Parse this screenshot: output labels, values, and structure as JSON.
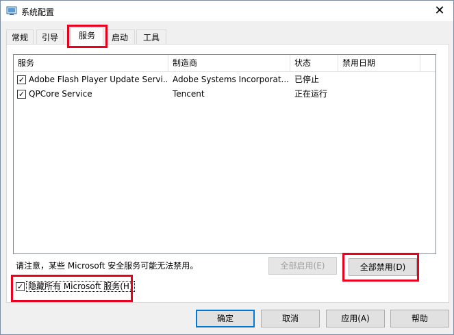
{
  "window": {
    "title": "系统配置"
  },
  "tabs": [
    {
      "label": "常规"
    },
    {
      "label": "引导"
    },
    {
      "label": "服务"
    },
    {
      "label": "启动"
    },
    {
      "label": "工具"
    }
  ],
  "table": {
    "headers": [
      "服务",
      "制造商",
      "状态",
      "禁用日期"
    ],
    "rows": [
      {
        "checked": true,
        "service": "Adobe Flash Player Update Servi...",
        "vendor": "Adobe Systems Incorporat...",
        "status": "已停止",
        "date": ""
      },
      {
        "checked": true,
        "service": "QPCore Service",
        "vendor": "Tencent",
        "status": "正在运行",
        "date": ""
      }
    ]
  },
  "note": "请注意，某些 Microsoft 安全服务可能无法禁用。",
  "buttons": {
    "enable_all": "全部启用(E)",
    "disable_all": "全部禁用(D)",
    "ok": "确定",
    "cancel": "取消",
    "apply": "应用(A)",
    "help": "帮助"
  },
  "hide_microsoft": {
    "label": "隐藏所有 Microsoft 服务(H)",
    "checked": true
  },
  "highlight_color": "#e8001c"
}
